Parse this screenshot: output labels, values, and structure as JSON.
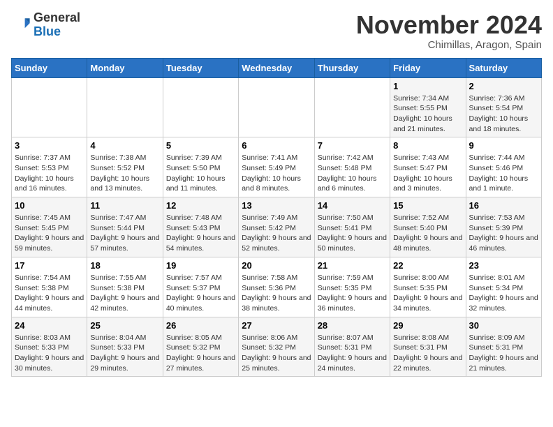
{
  "header": {
    "logo_general": "General",
    "logo_blue": "Blue",
    "month": "November 2024",
    "location": "Chimillas, Aragon, Spain"
  },
  "days_of_week": [
    "Sunday",
    "Monday",
    "Tuesday",
    "Wednesday",
    "Thursday",
    "Friday",
    "Saturday"
  ],
  "weeks": [
    [
      {
        "day": "",
        "info": ""
      },
      {
        "day": "",
        "info": ""
      },
      {
        "day": "",
        "info": ""
      },
      {
        "day": "",
        "info": ""
      },
      {
        "day": "",
        "info": ""
      },
      {
        "day": "1",
        "info": "Sunrise: 7:34 AM\nSunset: 5:55 PM\nDaylight: 10 hours and 21 minutes."
      },
      {
        "day": "2",
        "info": "Sunrise: 7:36 AM\nSunset: 5:54 PM\nDaylight: 10 hours and 18 minutes."
      }
    ],
    [
      {
        "day": "3",
        "info": "Sunrise: 7:37 AM\nSunset: 5:53 PM\nDaylight: 10 hours and 16 minutes."
      },
      {
        "day": "4",
        "info": "Sunrise: 7:38 AM\nSunset: 5:52 PM\nDaylight: 10 hours and 13 minutes."
      },
      {
        "day": "5",
        "info": "Sunrise: 7:39 AM\nSunset: 5:50 PM\nDaylight: 10 hours and 11 minutes."
      },
      {
        "day": "6",
        "info": "Sunrise: 7:41 AM\nSunset: 5:49 PM\nDaylight: 10 hours and 8 minutes."
      },
      {
        "day": "7",
        "info": "Sunrise: 7:42 AM\nSunset: 5:48 PM\nDaylight: 10 hours and 6 minutes."
      },
      {
        "day": "8",
        "info": "Sunrise: 7:43 AM\nSunset: 5:47 PM\nDaylight: 10 hours and 3 minutes."
      },
      {
        "day": "9",
        "info": "Sunrise: 7:44 AM\nSunset: 5:46 PM\nDaylight: 10 hours and 1 minute."
      }
    ],
    [
      {
        "day": "10",
        "info": "Sunrise: 7:45 AM\nSunset: 5:45 PM\nDaylight: 9 hours and 59 minutes."
      },
      {
        "day": "11",
        "info": "Sunrise: 7:47 AM\nSunset: 5:44 PM\nDaylight: 9 hours and 57 minutes."
      },
      {
        "day": "12",
        "info": "Sunrise: 7:48 AM\nSunset: 5:43 PM\nDaylight: 9 hours and 54 minutes."
      },
      {
        "day": "13",
        "info": "Sunrise: 7:49 AM\nSunset: 5:42 PM\nDaylight: 9 hours and 52 minutes."
      },
      {
        "day": "14",
        "info": "Sunrise: 7:50 AM\nSunset: 5:41 PM\nDaylight: 9 hours and 50 minutes."
      },
      {
        "day": "15",
        "info": "Sunrise: 7:52 AM\nSunset: 5:40 PM\nDaylight: 9 hours and 48 minutes."
      },
      {
        "day": "16",
        "info": "Sunrise: 7:53 AM\nSunset: 5:39 PM\nDaylight: 9 hours and 46 minutes."
      }
    ],
    [
      {
        "day": "17",
        "info": "Sunrise: 7:54 AM\nSunset: 5:38 PM\nDaylight: 9 hours and 44 minutes."
      },
      {
        "day": "18",
        "info": "Sunrise: 7:55 AM\nSunset: 5:38 PM\nDaylight: 9 hours and 42 minutes."
      },
      {
        "day": "19",
        "info": "Sunrise: 7:57 AM\nSunset: 5:37 PM\nDaylight: 9 hours and 40 minutes."
      },
      {
        "day": "20",
        "info": "Sunrise: 7:58 AM\nSunset: 5:36 PM\nDaylight: 9 hours and 38 minutes."
      },
      {
        "day": "21",
        "info": "Sunrise: 7:59 AM\nSunset: 5:35 PM\nDaylight: 9 hours and 36 minutes."
      },
      {
        "day": "22",
        "info": "Sunrise: 8:00 AM\nSunset: 5:35 PM\nDaylight: 9 hours and 34 minutes."
      },
      {
        "day": "23",
        "info": "Sunrise: 8:01 AM\nSunset: 5:34 PM\nDaylight: 9 hours and 32 minutes."
      }
    ],
    [
      {
        "day": "24",
        "info": "Sunrise: 8:03 AM\nSunset: 5:33 PM\nDaylight: 9 hours and 30 minutes."
      },
      {
        "day": "25",
        "info": "Sunrise: 8:04 AM\nSunset: 5:33 PM\nDaylight: 9 hours and 29 minutes."
      },
      {
        "day": "26",
        "info": "Sunrise: 8:05 AM\nSunset: 5:32 PM\nDaylight: 9 hours and 27 minutes."
      },
      {
        "day": "27",
        "info": "Sunrise: 8:06 AM\nSunset: 5:32 PM\nDaylight: 9 hours and 25 minutes."
      },
      {
        "day": "28",
        "info": "Sunrise: 8:07 AM\nSunset: 5:31 PM\nDaylight: 9 hours and 24 minutes."
      },
      {
        "day": "29",
        "info": "Sunrise: 8:08 AM\nSunset: 5:31 PM\nDaylight: 9 hours and 22 minutes."
      },
      {
        "day": "30",
        "info": "Sunrise: 8:09 AM\nSunset: 5:31 PM\nDaylight: 9 hours and 21 minutes."
      }
    ]
  ]
}
